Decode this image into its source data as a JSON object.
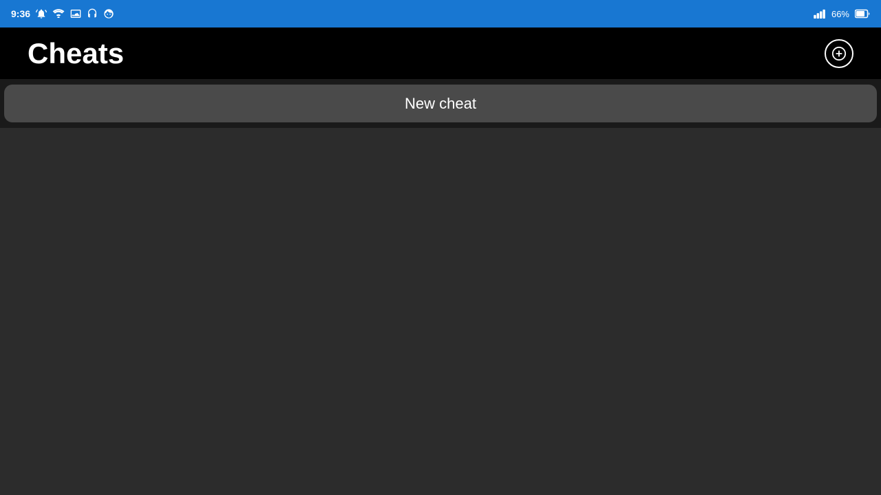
{
  "statusBar": {
    "time": "9:36",
    "batteryPercent": "66%",
    "icons": {
      "alarm": "⏰",
      "sync": "☁",
      "gallery": "🖼",
      "headset": "🎧",
      "face": "☺"
    }
  },
  "header": {
    "title": "Cheats",
    "addButtonLabel": "Add"
  },
  "newCheatButton": {
    "label": "New cheat"
  }
}
